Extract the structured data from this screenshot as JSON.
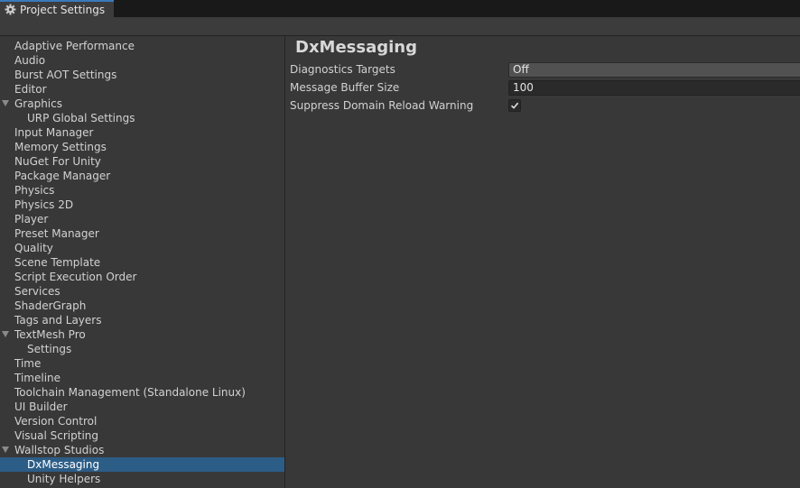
{
  "window": {
    "tab_title": "Project Settings",
    "tab_icon": "gear-icon"
  },
  "colors": {
    "selection": "#2c5d87",
    "tab_accent": "#3a79bb"
  },
  "sidebar": {
    "items": [
      {
        "label": "Adaptive Performance",
        "level": 0,
        "foldout": false
      },
      {
        "label": "Audio",
        "level": 0,
        "foldout": false
      },
      {
        "label": "Burst AOT Settings",
        "level": 0,
        "foldout": false
      },
      {
        "label": "Editor",
        "level": 0,
        "foldout": false
      },
      {
        "label": "Graphics",
        "level": 0,
        "foldout": true
      },
      {
        "label": "URP Global Settings",
        "level": 1,
        "foldout": false
      },
      {
        "label": "Input Manager",
        "level": 0,
        "foldout": false
      },
      {
        "label": "Memory Settings",
        "level": 0,
        "foldout": false
      },
      {
        "label": "NuGet For Unity",
        "level": 0,
        "foldout": false
      },
      {
        "label": "Package Manager",
        "level": 0,
        "foldout": false
      },
      {
        "label": "Physics",
        "level": 0,
        "foldout": false
      },
      {
        "label": "Physics 2D",
        "level": 0,
        "foldout": false
      },
      {
        "label": "Player",
        "level": 0,
        "foldout": false
      },
      {
        "label": "Preset Manager",
        "level": 0,
        "foldout": false
      },
      {
        "label": "Quality",
        "level": 0,
        "foldout": false
      },
      {
        "label": "Scene Template",
        "level": 0,
        "foldout": false
      },
      {
        "label": "Script Execution Order",
        "level": 0,
        "foldout": false
      },
      {
        "label": "Services",
        "level": 0,
        "foldout": false
      },
      {
        "label": "ShaderGraph",
        "level": 0,
        "foldout": false
      },
      {
        "label": "Tags and Layers",
        "level": 0,
        "foldout": false
      },
      {
        "label": "TextMesh Pro",
        "level": 0,
        "foldout": true
      },
      {
        "label": "Settings",
        "level": 1,
        "foldout": false
      },
      {
        "label": "Time",
        "level": 0,
        "foldout": false
      },
      {
        "label": "Timeline",
        "level": 0,
        "foldout": false
      },
      {
        "label": "Toolchain Management (Standalone Linux)",
        "level": 0,
        "foldout": false
      },
      {
        "label": "UI Builder",
        "level": 0,
        "foldout": false
      },
      {
        "label": "Version Control",
        "level": 0,
        "foldout": false
      },
      {
        "label": "Visual Scripting",
        "level": 0,
        "foldout": false
      },
      {
        "label": "Wallstop Studios",
        "level": 0,
        "foldout": true
      },
      {
        "label": "DxMessaging",
        "level": 1,
        "foldout": false,
        "selected": true
      },
      {
        "label": "Unity Helpers",
        "level": 1,
        "foldout": false
      }
    ]
  },
  "main": {
    "title": "DxMessaging",
    "fields": {
      "diagnostics_targets": {
        "label": "Diagnostics Targets",
        "value": "Off"
      },
      "message_buffer_size": {
        "label": "Message Buffer Size",
        "value": "100"
      },
      "suppress_domain_reload_warning": {
        "label": "Suppress Domain Reload Warning",
        "checked": true
      }
    }
  }
}
